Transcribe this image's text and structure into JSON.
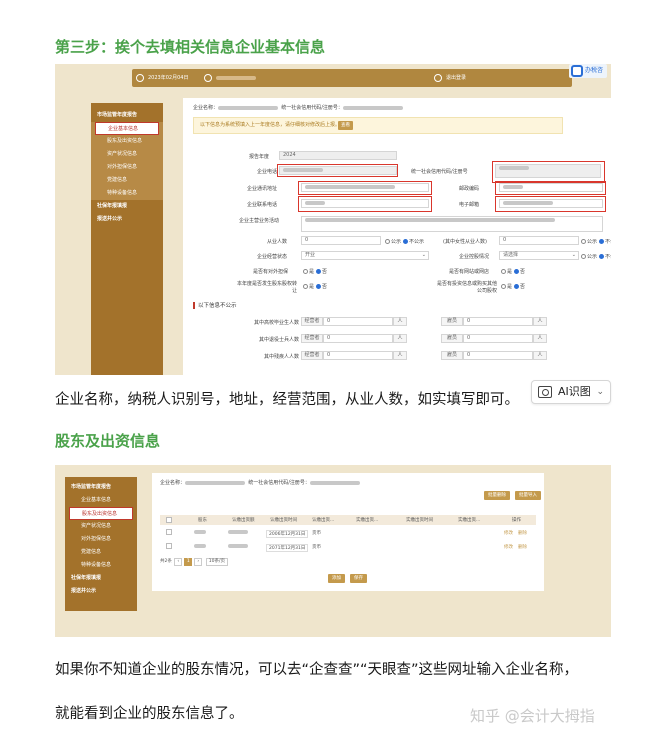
{
  "step3_heading": "第三步：挨个去填相关信息企业基本信息",
  "shot1": {
    "topbar": {
      "date": "2023年02月04日",
      "exit": "退出登录"
    },
    "tax_link": "办税咨",
    "sidebar": {
      "group1": "市场监管年度报告",
      "items": [
        "企业基本信息",
        "股东及出资信息",
        "资产状况信息",
        "对外担保信息",
        "党建信息",
        "特种设备信息"
      ],
      "group2": "社保年报填报",
      "group3": "报送并公示"
    },
    "form": {
      "company_label": "企业名称：",
      "credit_code_label": "统一社会信用代码/注册号：",
      "notice": "以下信息为系统预填入上一年度信息，请仔细核对修改后上报。",
      "notice_btn": "查看",
      "year_label": "报告年度",
      "year_value": "2024",
      "phone_label": "企业电话",
      "code2_label": "统一社会信用代码/注册号",
      "address_label": "企业通讯地址",
      "postcode_label": "邮政编码",
      "contact_phone_label": "企业联系电话",
      "email_label": "电子邮箱",
      "scope_label": "企业主营业务活动",
      "employees_label": "从业人数",
      "employees_value": "0",
      "female_label": "(其中女性从业人数)",
      "female_value": "0",
      "public_label": "公示",
      "nonpublic_label": "不公示",
      "status_label": "企业经营状态",
      "status_value": "开业",
      "holding_label": "企业控股情况",
      "holding_value": "请选择",
      "guarantee_label": "是否有对外担保",
      "website_label": "是否有网站或网店",
      "transfer_label": "本年度是否发生股东股权转让",
      "invest_label": "是否有投资信息或购买其他公司股权",
      "yes": "是",
      "no": "否",
      "nonpublic_section": "以下信息不公示",
      "rows": [
        {
          "label": "其中高校毕业生人数",
          "left": "经营者",
          "lval": "0",
          "right": "雇员",
          "rval": "0"
        },
        {
          "label": "其中退役士兵人数",
          "left": "经营者",
          "lval": "0",
          "right": "雇员",
          "rval": "0"
        },
        {
          "label": "其中残疾人人数",
          "left": "经营者",
          "lval": "0",
          "right": "雇员",
          "rval": "0"
        }
      ],
      "unit": "人"
    }
  },
  "paragraph1": "企业名称，纳税人识别号，地址，经营范围，从业人数，如实填写即可。",
  "ai_chip": "AI识图",
  "shareholder_heading": "股东及出资信息",
  "shot2": {
    "sidebar": {
      "group1": "市场监管年度报告",
      "items": [
        "企业基本信息",
        "股东及出资信息",
        "资产状况信息",
        "对外担保信息",
        "党建信息",
        "特种设备信息"
      ],
      "group2": "社保年报填报",
      "group3": "报送并公示"
    },
    "company_label": "企业名称：",
    "credit_code_label": "统一社会信用代码/注册号：",
    "btn_delete": "批量删除",
    "btn_import": "批量导入",
    "columns": [
      "股东",
      "认缴出资额",
      "认缴出资时间",
      "认缴出资...",
      "实缴出资...",
      "实缴出资时间",
      "实缴出资...",
      "操作"
    ],
    "rows": [
      {
        "date": "2006年12月31日",
        "type": "货币",
        "ops": [
          "修改",
          "删除"
        ]
      },
      {
        "date": "2071年12月31日",
        "type": "货币",
        "ops": [
          "修改",
          "删除"
        ]
      }
    ],
    "pager": {
      "total": "共2条",
      "page": "1",
      "per_page": "10条/页"
    },
    "btn_add": "添加",
    "btn_save": "保存"
  },
  "paragraph2": "如果你不知道企业的股东情况，可以去“企查查”“天眼查”这些网址输入企业名称，",
  "paragraph3": "就能看到企业的股东信息了。",
  "watermark": "知乎 @会计大拇指"
}
